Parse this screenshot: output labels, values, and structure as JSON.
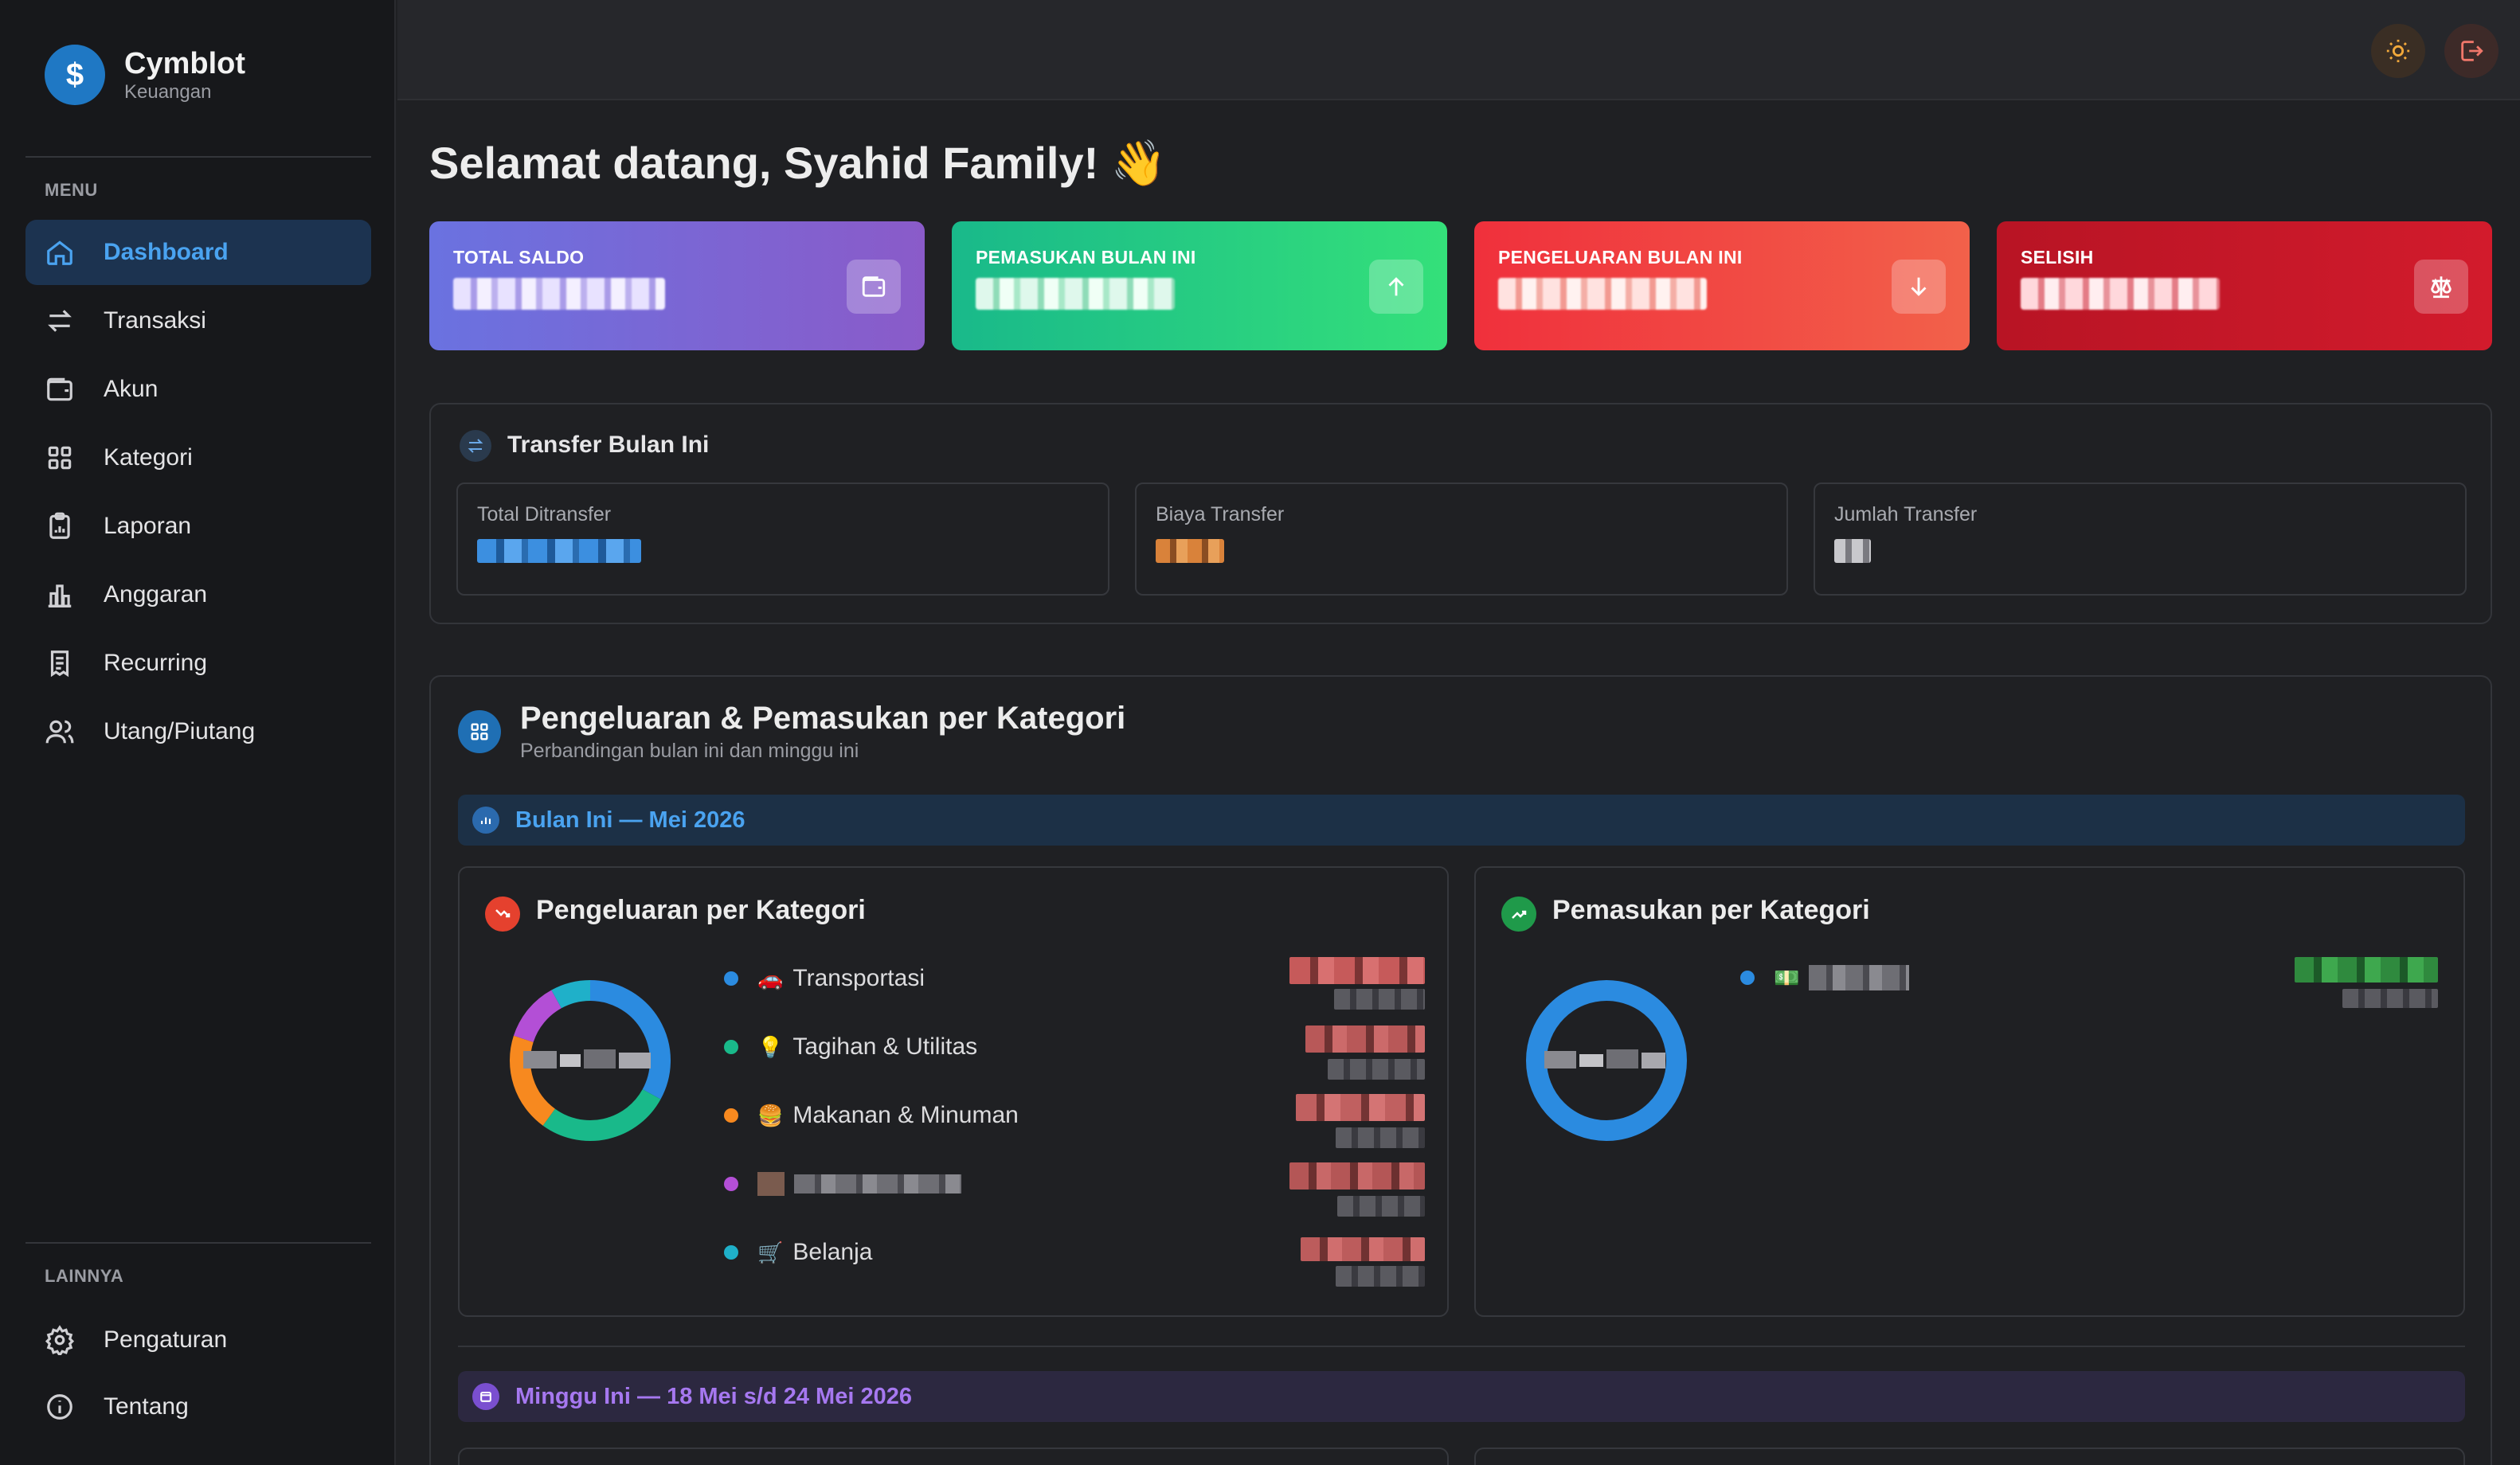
{
  "brand": {
    "name": "Cymblot",
    "subtitle": "Keuangan",
    "logo_symbol": "$"
  },
  "sidebar": {
    "menu_label": "MENU",
    "items": [
      {
        "label": "Dashboard",
        "icon": "home-icon",
        "active": true
      },
      {
        "label": "Transaksi",
        "icon": "arrows-swap-icon"
      },
      {
        "label": "Akun",
        "icon": "wallet-icon"
      },
      {
        "label": "Kategori",
        "icon": "grid-icon"
      },
      {
        "label": "Laporan",
        "icon": "clipboard-icon"
      },
      {
        "label": "Anggaran",
        "icon": "bar-chart-icon"
      },
      {
        "label": "Recurring",
        "icon": "receipt-icon"
      },
      {
        "label": "Utang/Piutang",
        "icon": "users-icon"
      }
    ],
    "other_label": "LAINNYA",
    "other_items": [
      {
        "label": "Pengaturan",
        "icon": "gear-icon"
      },
      {
        "label": "Tentang",
        "icon": "info-icon"
      }
    ]
  },
  "topbar": {
    "theme_toggle_icon": "sun-icon",
    "logout_icon": "logout-icon"
  },
  "welcome": "Selamat datang, Syahid Family! 👋",
  "summary_cards": [
    {
      "title": "TOTAL SALDO",
      "icon": "wallet-icon",
      "gradient": [
        "#6a72e0",
        "#8a5bc9"
      ]
    },
    {
      "title": "PEMASUKAN BULAN INI",
      "icon": "arrow-up-icon",
      "gradient": [
        "#19b98a",
        "#34e07a"
      ]
    },
    {
      "title": "PENGELUARAN BULAN INI",
      "icon": "arrow-down-icon",
      "gradient": [
        "#f0303c",
        "#f2614a"
      ]
    },
    {
      "title": "SELISIH",
      "icon": "scale-icon",
      "gradient": [
        "#b81424",
        "#d21b2c"
      ]
    }
  ],
  "transfer": {
    "title": "Transfer Bulan Ini",
    "stats": [
      {
        "label": "Total Ditransfer"
      },
      {
        "label": "Biaya Transfer"
      },
      {
        "label": "Jumlah Transfer"
      }
    ]
  },
  "category_section": {
    "title": "Pengeluaran & Pemasukan per Kategori",
    "subtitle": "Perbandingan bulan ini dan minggu ini",
    "month_label": "Bulan Ini — Mei 2026",
    "week_label": "Minggu Ini — 18 Mei s/d 24 Mei 2026",
    "expense_title": "Pengeluaran per Kategori",
    "income_title": "Pemasukan per Kategori",
    "expense_legend": [
      {
        "emoji": "🚗",
        "label": "Transportasi",
        "color": "#2b8be0"
      },
      {
        "emoji": "💡",
        "label": "Tagihan & Utilitas",
        "color": "#19b98a"
      },
      {
        "emoji": "🍔",
        "label": "Makanan & Minuman",
        "color": "#f7891f"
      },
      {
        "emoji": "",
        "label": "",
        "color": "#b34fd6"
      },
      {
        "emoji": "🛒",
        "label": "Belanja",
        "color": "#1fb0c9"
      }
    ],
    "income_legend": [
      {
        "emoji": "💵",
        "label": "",
        "color": "#2b8be0"
      }
    ]
  },
  "chart_data": [
    {
      "type": "pie",
      "title": "Pengeluaran per Kategori",
      "categories": [
        "Transportasi",
        "Tagihan & Utilitas",
        "Makanan & Minuman",
        "",
        "Belanja"
      ],
      "values": [
        33,
        27,
        20,
        12,
        8
      ]
    },
    {
      "type": "pie",
      "title": "Pemasukan per Kategori",
      "categories": [
        ""
      ],
      "values": [
        100
      ]
    }
  ]
}
